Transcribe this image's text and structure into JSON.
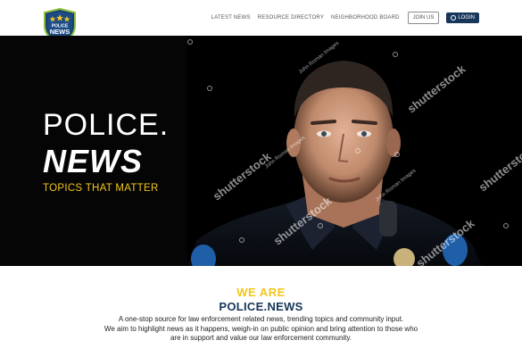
{
  "header": {
    "logo": {
      "line1": "POLICE",
      "line2": "NEWS",
      "icon": "shield-badge-icon"
    },
    "nav": [
      {
        "label": "LATEST NEWS"
      },
      {
        "label": "RESOURCE DIRECTORY"
      },
      {
        "label": "NEIGHBORHOOD BOARD"
      }
    ],
    "join_label": "JOIN US",
    "login_label": "LOGIN",
    "login_icon": "user-icon"
  },
  "hero": {
    "line1": "POLICE.",
    "line2": "NEWS",
    "tagline": "TOPICS THAT MATTER",
    "photo_subject": "police-officer-portrait",
    "watermark": "shutterstock",
    "watermark_credit": "John Roman Images"
  },
  "about": {
    "heading1": "WE ARE",
    "heading2": "POLICE.NEWS",
    "body": [
      "A one-stop source for law enforcement related news, trending topics and community input.",
      "We aim to highlight news as it happens, weigh-in on public opinion and bring attention to those who",
      "are in support and value our law enforcement community."
    ]
  },
  "colors": {
    "accent_yellow": "#f2c61f",
    "brand_navy": "#18365a",
    "hero_bg": "#050505"
  }
}
